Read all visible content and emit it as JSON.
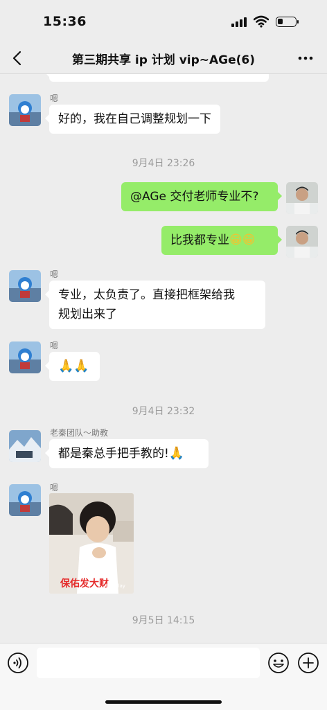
{
  "status_bar": {
    "time": "15:36",
    "battery_level": 0.3
  },
  "header": {
    "title": "第三期共享 ip 计划 vip~AGe(6)"
  },
  "messages": [
    {
      "sender": "嗯",
      "text": "好的，我在自己调整规划一下"
    },
    {
      "timestamp": "9月4日 23:26"
    },
    {
      "text": "@AGe 交付老师专业不?"
    },
    {
      "text": "比我都专业",
      "emoji": "😁😁"
    },
    {
      "sender": "嗯",
      "text_line1": "专业，太负责了。直接把框架给我",
      "text_line2": "规划出来了"
    },
    {
      "sender": "嗯",
      "emoji": "🙏🙏"
    },
    {
      "timestamp": "9月4日 23:32"
    },
    {
      "sender": "老秦团队～助教",
      "text": "都是秦总手把手教的!",
      "emoji": "🙏"
    },
    {
      "sender": "嗯",
      "sticker_caption": "保佑发大财",
      "sticker_watermark": "ImgPlay"
    },
    {
      "timestamp": "9月5日 14:15"
    }
  ],
  "input": {
    "placeholder": ""
  },
  "icons": {
    "back": "chevron-left-icon",
    "more": "more-icon",
    "voice": "voice-icon",
    "emoji": "emoji-icon",
    "plus": "plus-icon"
  },
  "colors": {
    "sent_bubble": "#95ec69",
    "received_bubble": "#ffffff",
    "background": "#ededed"
  }
}
